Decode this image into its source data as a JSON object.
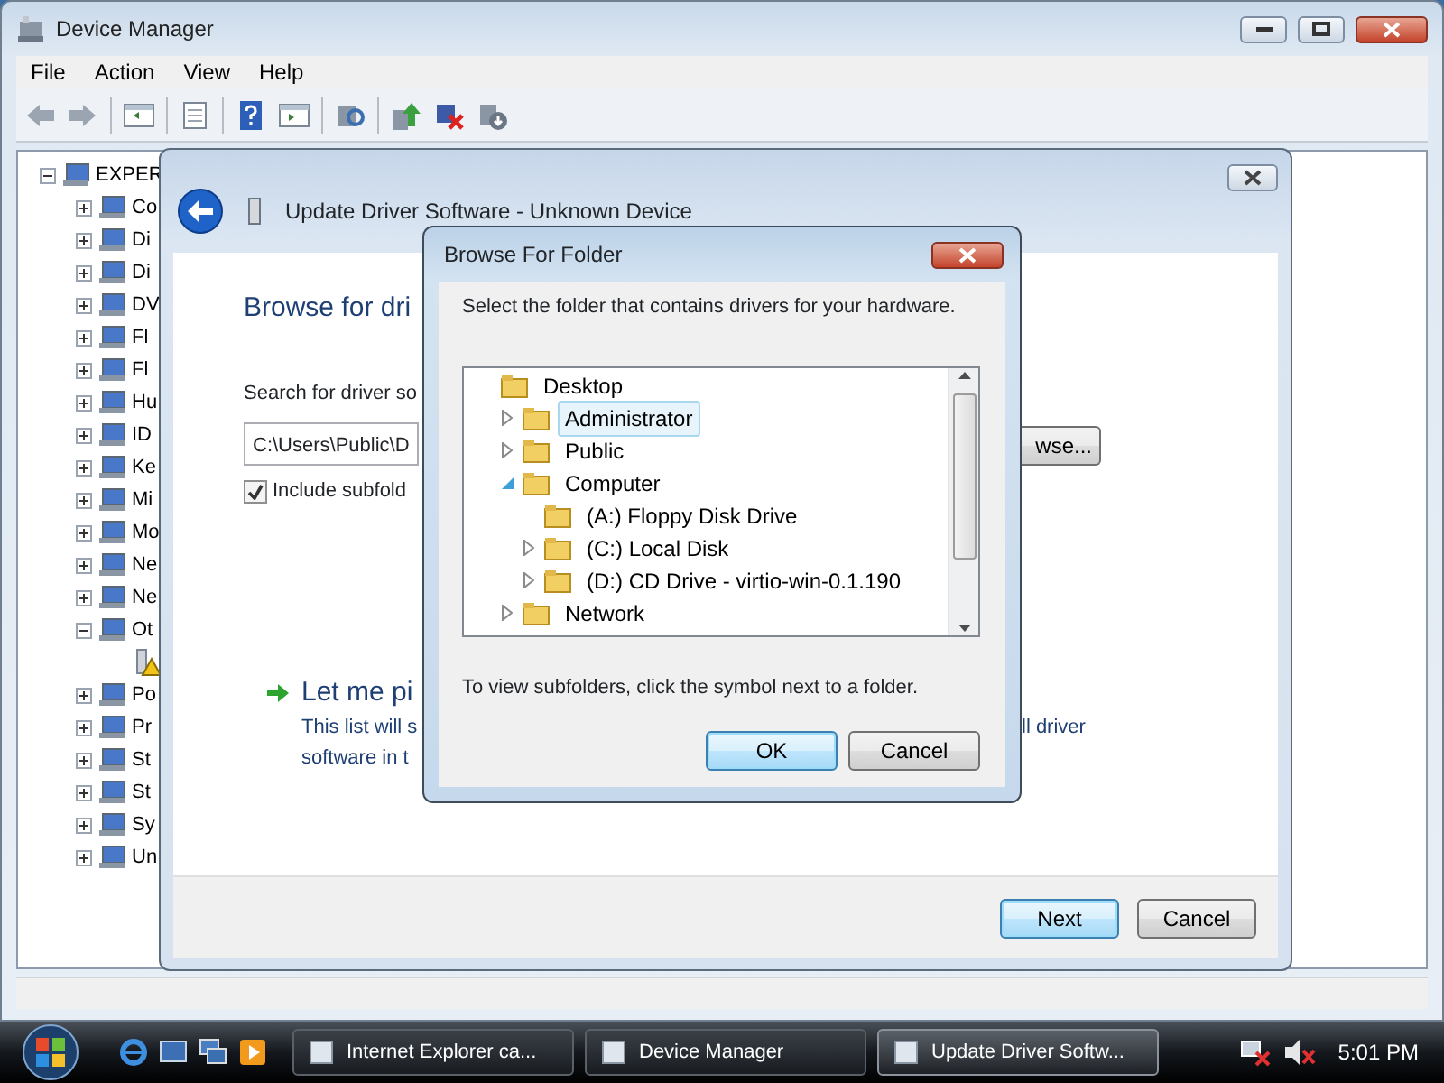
{
  "device_manager": {
    "title": "Device Manager",
    "menu": [
      "File",
      "Action",
      "View",
      "Help"
    ],
    "tree": [
      {
        "label": "EXPER",
        "expanded": true,
        "children": [
          {
            "label": "Co",
            "expanded": false
          },
          {
            "label": "Di",
            "expanded": false
          },
          {
            "label": "Di",
            "expanded": false
          },
          {
            "label": "DV",
            "expanded": false
          },
          {
            "label": "Fl",
            "expanded": false
          },
          {
            "label": "Fl",
            "expanded": false
          },
          {
            "label": "Hu",
            "expanded": false
          },
          {
            "label": "ID",
            "expanded": false
          },
          {
            "label": "Ke",
            "expanded": false
          },
          {
            "label": "Mi",
            "expanded": false
          },
          {
            "label": "Mo",
            "expanded": false
          },
          {
            "label": "Ne",
            "expanded": false
          },
          {
            "label": "Ne",
            "expanded": false
          },
          {
            "label": "Ot",
            "expanded": true,
            "children": [
              {
                "warning": true
              }
            ]
          },
          {
            "label": "Po",
            "expanded": false
          },
          {
            "label": "Pr",
            "expanded": false
          },
          {
            "label": "St",
            "expanded": false
          },
          {
            "label": "St",
            "expanded": false
          },
          {
            "label": "Sy",
            "expanded": false
          },
          {
            "label": "Un",
            "expanded": false
          }
        ]
      }
    ]
  },
  "wizard": {
    "title": "Update Driver Software - Unknown Device",
    "heading": "Browse for dri",
    "search_label": "Search for driver so",
    "path": "C:\\Users\\Public\\D",
    "browse_button": "wse...",
    "include_subfolders": {
      "label": "Include subfold",
      "checked": true
    },
    "option_title": "Let me pi",
    "option_text": [
      "This list will s",
      "software in t"
    ],
    "option_text_right": "ll driver",
    "buttons": [
      {
        "label": "Next",
        "default": true
      },
      {
        "label": "Cancel",
        "default": false
      }
    ]
  },
  "browse_dialog": {
    "title": "Browse For Folder",
    "instruction": "Select the folder that contains drivers for your hardware.",
    "tree": [
      {
        "label": "Desktop",
        "selected": false,
        "children": [
          {
            "label": "Administrator",
            "expanded": false,
            "selected": true
          },
          {
            "label": "Public",
            "expanded": false,
            "selected": false
          },
          {
            "label": "Computer",
            "expanded": true,
            "selected": false,
            "children": [
              {
                "label": "(A:) Floppy Disk Drive",
                "selected": false
              },
              {
                "label": "(C:) Local Disk",
                "expanded": false,
                "selected": false
              },
              {
                "label": "(D:) CD Drive - virtio-win-0.1.190",
                "expanded": false,
                "selected": false
              }
            ]
          },
          {
            "label": "Network",
            "expanded": false,
            "selected": false
          }
        ]
      }
    ],
    "hint": "To view subfolders, click the symbol next to a folder.",
    "buttons": [
      {
        "label": "OK",
        "default": true
      },
      {
        "label": "Cancel",
        "default": false
      }
    ]
  },
  "taskbar": {
    "tasks": [
      {
        "label": "Internet Explorer ca...",
        "active": false
      },
      {
        "label": "Device Manager",
        "active": false
      },
      {
        "label": "Update Driver Softw...",
        "active": true
      }
    ],
    "clock": "5:01 PM"
  }
}
